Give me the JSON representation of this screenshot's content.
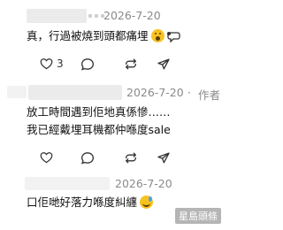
{
  "comments": [
    {
      "date": "2026-7-20",
      "text_lines": [
        "真，行過被燒到頭都痛埋"
      ],
      "emoji": [
        "face-with-open-mouth",
        "speech-bubble"
      ],
      "likes": "3",
      "author_tag": ""
    },
    {
      "date": "2026-7-20",
      "separator": "·",
      "author_tag": "作者",
      "text_lines": [
        "放工時間遇到佢地真係慘……",
        "我已經戴埋耳機都仲喺度sale"
      ],
      "likes": ""
    },
    {
      "date": "2026-7-20",
      "text_lines": [
        "口佢哋好落力喺度糾纏"
      ],
      "emoji": [
        "sweat-smile-face"
      ],
      "likes": ""
    }
  ],
  "watermark": "星島頭條",
  "icons": {
    "like": "heart-icon",
    "reply": "comment-icon",
    "repost": "repost-icon",
    "share": "share-icon"
  }
}
